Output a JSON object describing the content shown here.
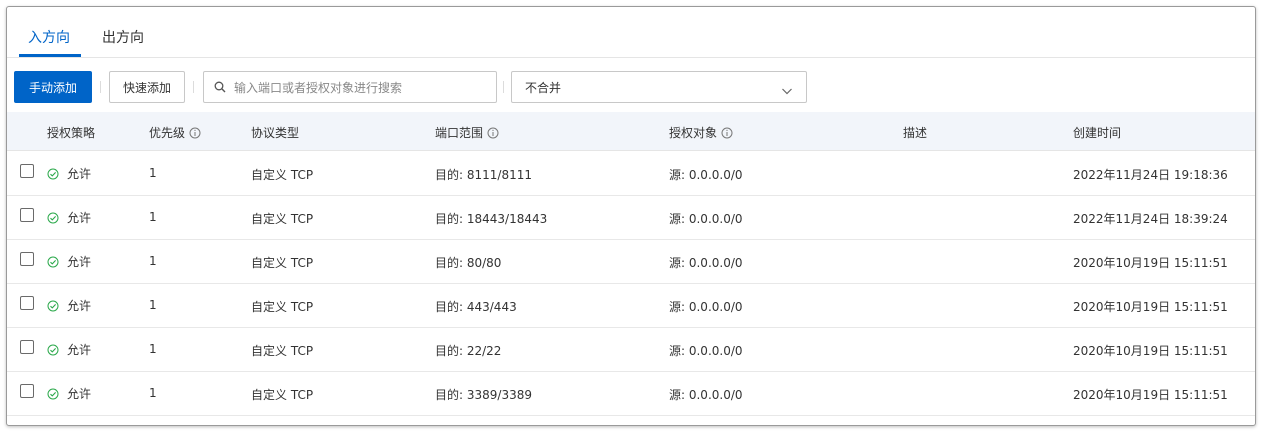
{
  "tabs": [
    {
      "label": "入方向",
      "active": true
    },
    {
      "label": "出方向",
      "active": false
    }
  ],
  "toolbar": {
    "manual_add": "手动添加",
    "quick_add": "快速添加",
    "search_placeholder": "输入端口或者授权对象进行搜索",
    "merge_select": "不合并"
  },
  "table": {
    "headers": [
      "授权策略",
      "优先级",
      "协议类型",
      "端口范围",
      "授权对象",
      "描述",
      "创建时间"
    ],
    "rows": [
      {
        "policy": "允许",
        "priority": "1",
        "protocol": "自定义 TCP",
        "port": "目的: 8111/8111",
        "object": "源: 0.0.0.0/0",
        "desc": "",
        "created": "2022年11月24日 19:18:36"
      },
      {
        "policy": "允许",
        "priority": "1",
        "protocol": "自定义 TCP",
        "port": "目的: 18443/18443",
        "object": "源: 0.0.0.0/0",
        "desc": "",
        "created": "2022年11月24日 18:39:24"
      },
      {
        "policy": "允许",
        "priority": "1",
        "protocol": "自定义 TCP",
        "port": "目的: 80/80",
        "object": "源: 0.0.0.0/0",
        "desc": "",
        "created": "2020年10月19日 15:11:51"
      },
      {
        "policy": "允许",
        "priority": "1",
        "protocol": "自定义 TCP",
        "port": "目的: 443/443",
        "object": "源: 0.0.0.0/0",
        "desc": "",
        "created": "2020年10月19日 15:11:51"
      },
      {
        "policy": "允许",
        "priority": "1",
        "protocol": "自定义 TCP",
        "port": "目的: 22/22",
        "object": "源: 0.0.0.0/0",
        "desc": "",
        "created": "2020年10月19日 15:11:51"
      },
      {
        "policy": "允许",
        "priority": "1",
        "protocol": "自定义 TCP",
        "port": "目的: 3389/3389",
        "object": "源: 0.0.0.0/0",
        "desc": "",
        "created": "2020年10月19日 15:11:51"
      }
    ]
  },
  "colors": {
    "accent": "#0064c8",
    "allow": "#1e8e3e",
    "header_bg": "#f2f5fa"
  },
  "icons": {
    "status": "check-circle-icon",
    "search": "search-icon",
    "info": "info-icon",
    "dropdown": "chevron-down-icon"
  }
}
